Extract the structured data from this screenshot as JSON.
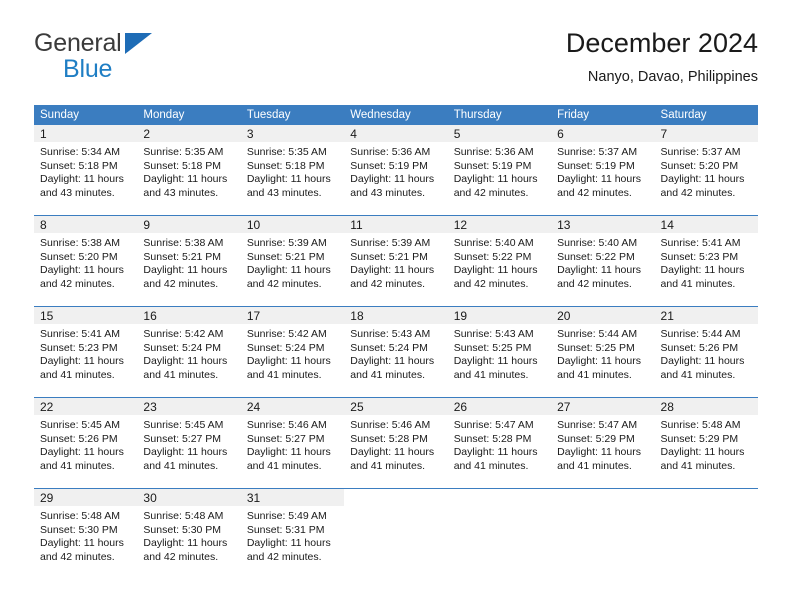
{
  "brand": {
    "logo_top": "General",
    "logo_bottom": "Blue",
    "triangle_color": "#1e6cb6",
    "blue_text_color": "#1f7ec4"
  },
  "header": {
    "title": "December 2024",
    "subtitle": "Nanyo, Davao, Philippines"
  },
  "theme": {
    "header_band": "#3b7dc0",
    "day_band": "#f0f0f0",
    "text": "#1a1a1a"
  },
  "weekdays": [
    "Sunday",
    "Monday",
    "Tuesday",
    "Wednesday",
    "Thursday",
    "Friday",
    "Saturday"
  ],
  "weeks": [
    [
      {
        "day": "1",
        "sunrise": "Sunrise: 5:34 AM",
        "sunset": "Sunset: 5:18 PM",
        "daylight": "Daylight: 11 hours and 43 minutes."
      },
      {
        "day": "2",
        "sunrise": "Sunrise: 5:35 AM",
        "sunset": "Sunset: 5:18 PM",
        "daylight": "Daylight: 11 hours and 43 minutes."
      },
      {
        "day": "3",
        "sunrise": "Sunrise: 5:35 AM",
        "sunset": "Sunset: 5:18 PM",
        "daylight": "Daylight: 11 hours and 43 minutes."
      },
      {
        "day": "4",
        "sunrise": "Sunrise: 5:36 AM",
        "sunset": "Sunset: 5:19 PM",
        "daylight": "Daylight: 11 hours and 43 minutes."
      },
      {
        "day": "5",
        "sunrise": "Sunrise: 5:36 AM",
        "sunset": "Sunset: 5:19 PM",
        "daylight": "Daylight: 11 hours and 42 minutes."
      },
      {
        "day": "6",
        "sunrise": "Sunrise: 5:37 AM",
        "sunset": "Sunset: 5:19 PM",
        "daylight": "Daylight: 11 hours and 42 minutes."
      },
      {
        "day": "7",
        "sunrise": "Sunrise: 5:37 AM",
        "sunset": "Sunset: 5:20 PM",
        "daylight": "Daylight: 11 hours and 42 minutes."
      }
    ],
    [
      {
        "day": "8",
        "sunrise": "Sunrise: 5:38 AM",
        "sunset": "Sunset: 5:20 PM",
        "daylight": "Daylight: 11 hours and 42 minutes."
      },
      {
        "day": "9",
        "sunrise": "Sunrise: 5:38 AM",
        "sunset": "Sunset: 5:21 PM",
        "daylight": "Daylight: 11 hours and 42 minutes."
      },
      {
        "day": "10",
        "sunrise": "Sunrise: 5:39 AM",
        "sunset": "Sunset: 5:21 PM",
        "daylight": "Daylight: 11 hours and 42 minutes."
      },
      {
        "day": "11",
        "sunrise": "Sunrise: 5:39 AM",
        "sunset": "Sunset: 5:21 PM",
        "daylight": "Daylight: 11 hours and 42 minutes."
      },
      {
        "day": "12",
        "sunrise": "Sunrise: 5:40 AM",
        "sunset": "Sunset: 5:22 PM",
        "daylight": "Daylight: 11 hours and 42 minutes."
      },
      {
        "day": "13",
        "sunrise": "Sunrise: 5:40 AM",
        "sunset": "Sunset: 5:22 PM",
        "daylight": "Daylight: 11 hours and 42 minutes."
      },
      {
        "day": "14",
        "sunrise": "Sunrise: 5:41 AM",
        "sunset": "Sunset: 5:23 PM",
        "daylight": "Daylight: 11 hours and 41 minutes."
      }
    ],
    [
      {
        "day": "15",
        "sunrise": "Sunrise: 5:41 AM",
        "sunset": "Sunset: 5:23 PM",
        "daylight": "Daylight: 11 hours and 41 minutes."
      },
      {
        "day": "16",
        "sunrise": "Sunrise: 5:42 AM",
        "sunset": "Sunset: 5:24 PM",
        "daylight": "Daylight: 11 hours and 41 minutes."
      },
      {
        "day": "17",
        "sunrise": "Sunrise: 5:42 AM",
        "sunset": "Sunset: 5:24 PM",
        "daylight": "Daylight: 11 hours and 41 minutes."
      },
      {
        "day": "18",
        "sunrise": "Sunrise: 5:43 AM",
        "sunset": "Sunset: 5:24 PM",
        "daylight": "Daylight: 11 hours and 41 minutes."
      },
      {
        "day": "19",
        "sunrise": "Sunrise: 5:43 AM",
        "sunset": "Sunset: 5:25 PM",
        "daylight": "Daylight: 11 hours and 41 minutes."
      },
      {
        "day": "20",
        "sunrise": "Sunrise: 5:44 AM",
        "sunset": "Sunset: 5:25 PM",
        "daylight": "Daylight: 11 hours and 41 minutes."
      },
      {
        "day": "21",
        "sunrise": "Sunrise: 5:44 AM",
        "sunset": "Sunset: 5:26 PM",
        "daylight": "Daylight: 11 hours and 41 minutes."
      }
    ],
    [
      {
        "day": "22",
        "sunrise": "Sunrise: 5:45 AM",
        "sunset": "Sunset: 5:26 PM",
        "daylight": "Daylight: 11 hours and 41 minutes."
      },
      {
        "day": "23",
        "sunrise": "Sunrise: 5:45 AM",
        "sunset": "Sunset: 5:27 PM",
        "daylight": "Daylight: 11 hours and 41 minutes."
      },
      {
        "day": "24",
        "sunrise": "Sunrise: 5:46 AM",
        "sunset": "Sunset: 5:27 PM",
        "daylight": "Daylight: 11 hours and 41 minutes."
      },
      {
        "day": "25",
        "sunrise": "Sunrise: 5:46 AM",
        "sunset": "Sunset: 5:28 PM",
        "daylight": "Daylight: 11 hours and 41 minutes."
      },
      {
        "day": "26",
        "sunrise": "Sunrise: 5:47 AM",
        "sunset": "Sunset: 5:28 PM",
        "daylight": "Daylight: 11 hours and 41 minutes."
      },
      {
        "day": "27",
        "sunrise": "Sunrise: 5:47 AM",
        "sunset": "Sunset: 5:29 PM",
        "daylight": "Daylight: 11 hours and 41 minutes."
      },
      {
        "day": "28",
        "sunrise": "Sunrise: 5:48 AM",
        "sunset": "Sunset: 5:29 PM",
        "daylight": "Daylight: 11 hours and 41 minutes."
      }
    ],
    [
      {
        "day": "29",
        "sunrise": "Sunrise: 5:48 AM",
        "sunset": "Sunset: 5:30 PM",
        "daylight": "Daylight: 11 hours and 42 minutes."
      },
      {
        "day": "30",
        "sunrise": "Sunrise: 5:48 AM",
        "sunset": "Sunset: 5:30 PM",
        "daylight": "Daylight: 11 hours and 42 minutes."
      },
      {
        "day": "31",
        "sunrise": "Sunrise: 5:49 AM",
        "sunset": "Sunset: 5:31 PM",
        "daylight": "Daylight: 11 hours and 42 minutes."
      },
      {
        "day": "",
        "sunrise": "",
        "sunset": "",
        "daylight": ""
      },
      {
        "day": "",
        "sunrise": "",
        "sunset": "",
        "daylight": ""
      },
      {
        "day": "",
        "sunrise": "",
        "sunset": "",
        "daylight": ""
      },
      {
        "day": "",
        "sunrise": "",
        "sunset": "",
        "daylight": ""
      }
    ]
  ]
}
